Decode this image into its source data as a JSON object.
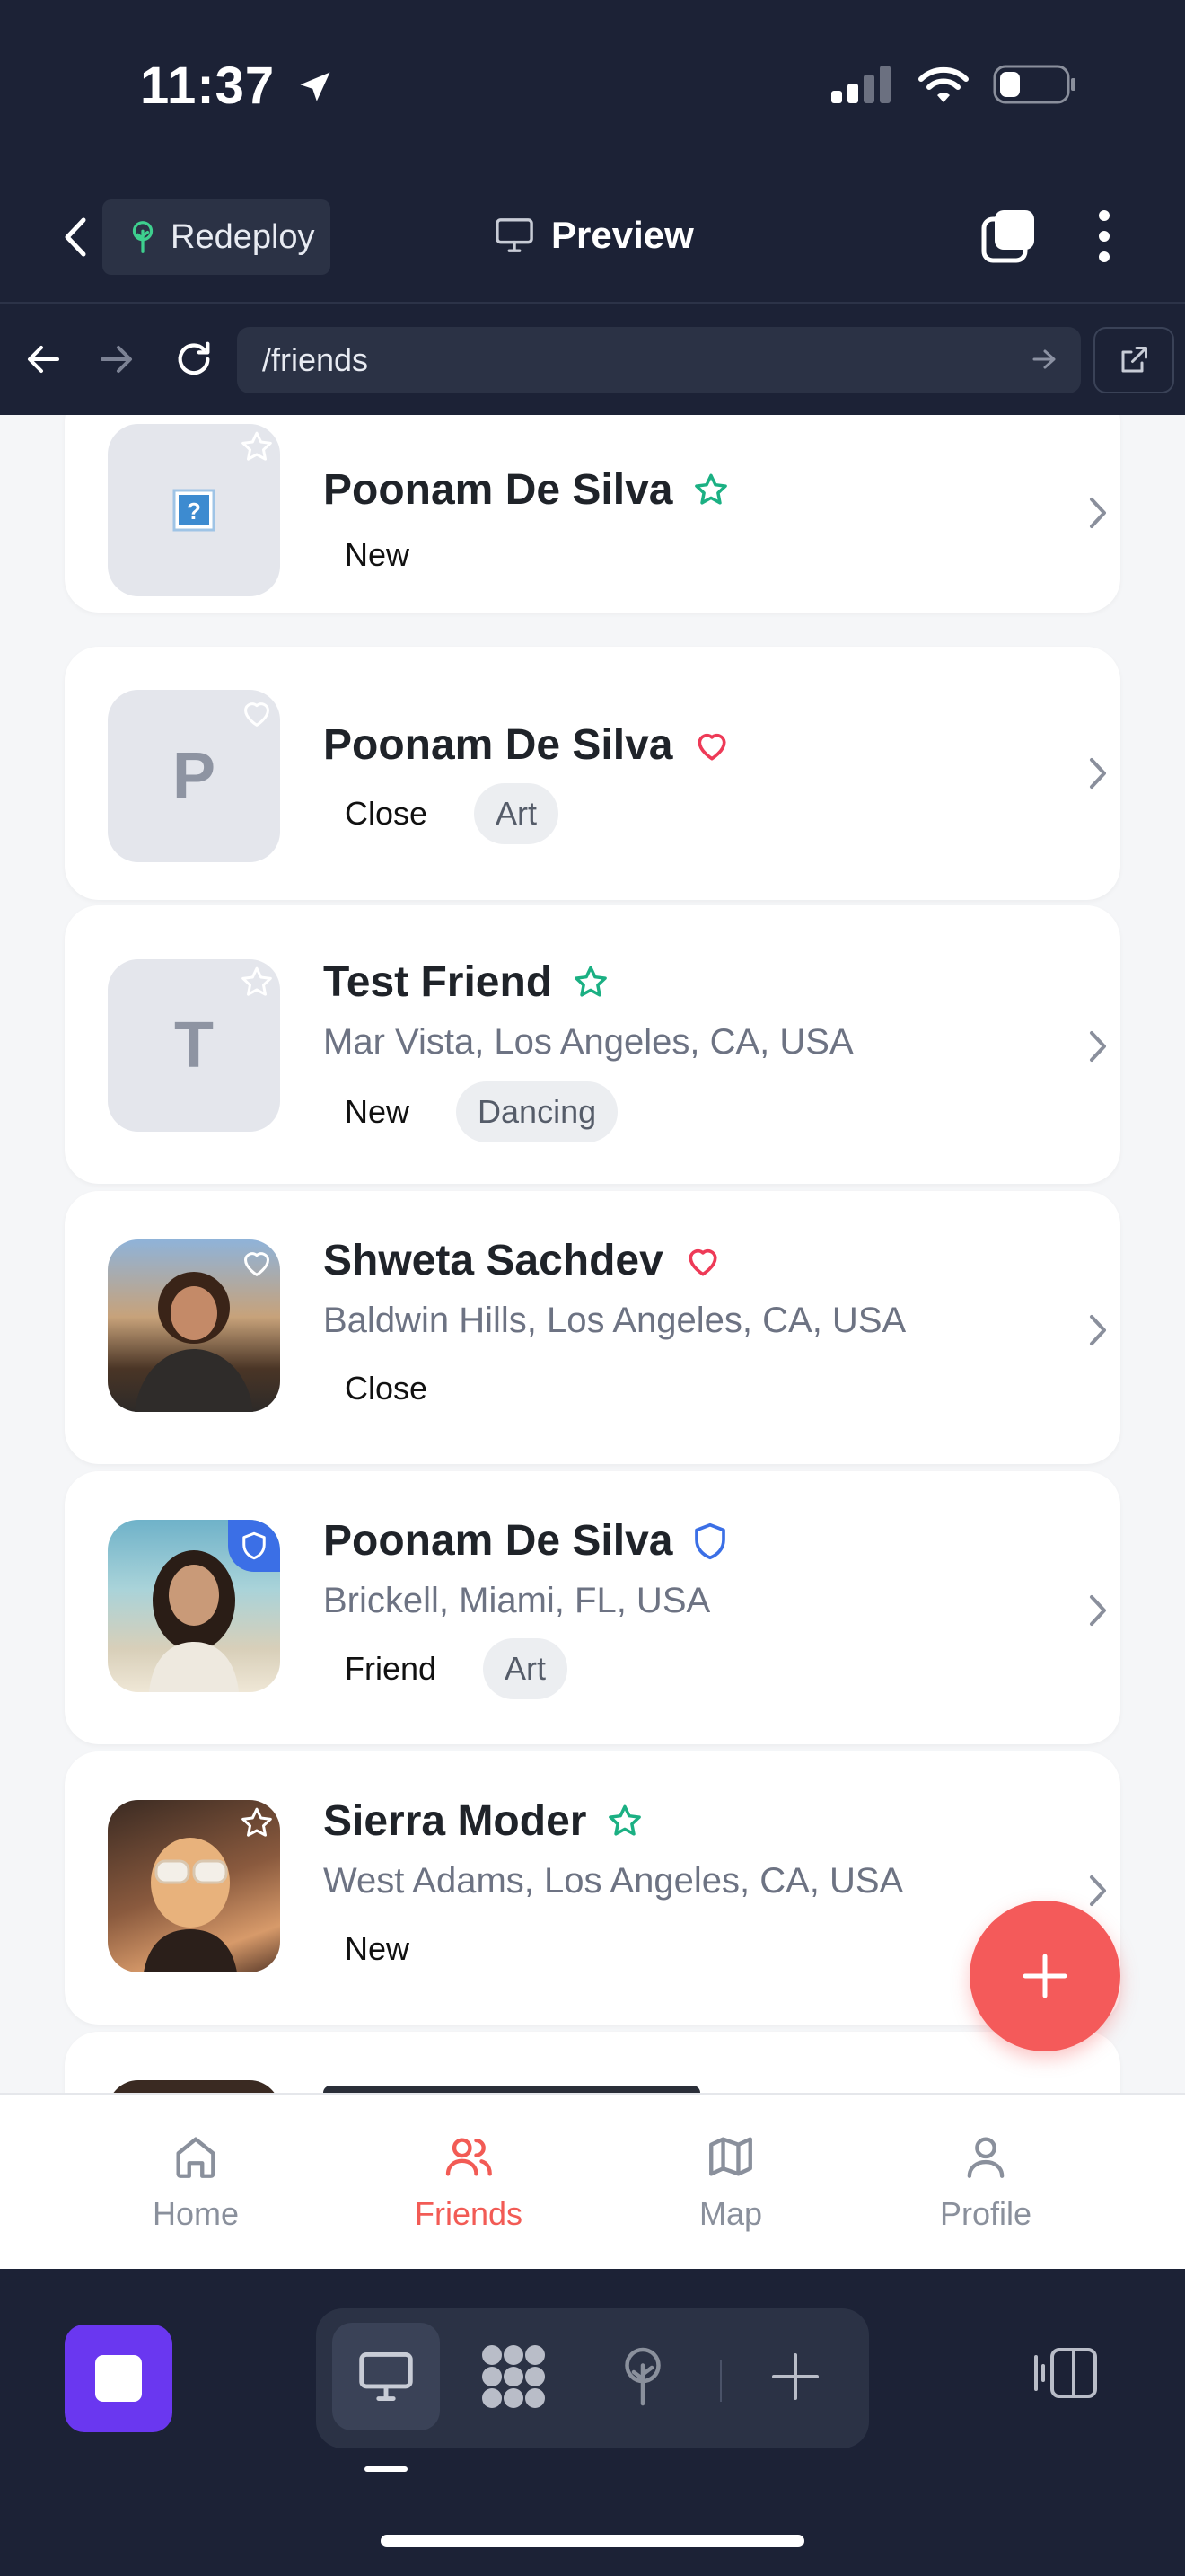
{
  "status": {
    "time": "11:37"
  },
  "header": {
    "redeploy_label": "Redeploy",
    "preview_label": "Preview"
  },
  "browser": {
    "url": "/friends"
  },
  "friends": [
    {
      "name": "Poonam De Silva",
      "location": "",
      "tags": [
        "New"
      ],
      "pills": [],
      "badge": "star",
      "avatar": "?"
    },
    {
      "name": "Poonam De Silva",
      "location": "",
      "tags": [
        "Close"
      ],
      "pills": [
        "Art"
      ],
      "badge": "heart",
      "avatar": "P"
    },
    {
      "name": "Test Friend",
      "location": "Mar Vista, Los Angeles, CA, USA",
      "tags": [
        "New"
      ],
      "pills": [
        "Dancing"
      ],
      "badge": "star",
      "avatar": "T"
    },
    {
      "name": "Shweta Sachdev",
      "location": "Baldwin Hills, Los Angeles, CA, USA",
      "tags": [
        "Close"
      ],
      "pills": [],
      "badge": "heart",
      "avatar": "photo"
    },
    {
      "name": "Poonam De Silva",
      "location": "Brickell, Miami, FL, USA",
      "tags": [
        "Friend"
      ],
      "pills": [
        "Art"
      ],
      "badge": "shield",
      "avatar": "photo"
    },
    {
      "name": "Sierra Moder",
      "location": "West Adams, Los Angeles, CA, USA",
      "tags": [
        "New"
      ],
      "pills": [],
      "badge": "star",
      "avatar": "photo"
    }
  ],
  "tabs": [
    {
      "label": "Home",
      "icon": "home-icon"
    },
    {
      "label": "Friends",
      "icon": "users-icon",
      "active": true
    },
    {
      "label": "Map",
      "icon": "map-icon"
    },
    {
      "label": "Profile",
      "icon": "user-icon"
    }
  ],
  "colors": {
    "accent": "#f25b55",
    "star": "#1bb083",
    "heart": "#ee3a57",
    "shield": "#3b6fe6",
    "dock": "#1c2236",
    "stop": "#6a37f0"
  }
}
